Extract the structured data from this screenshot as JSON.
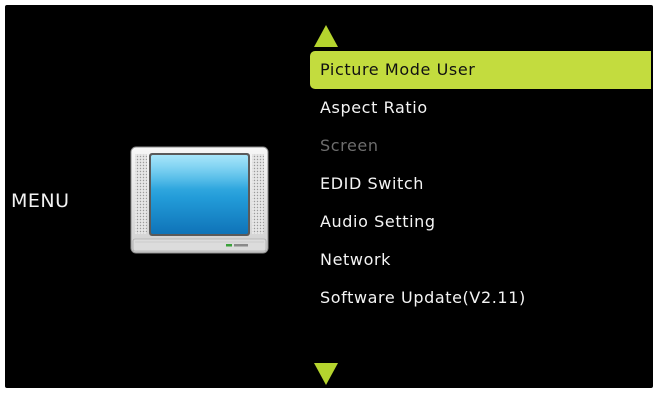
{
  "menu": {
    "title": "MENU",
    "scroll_up_icon": "triangle-up",
    "scroll_down_icon": "triangle-down",
    "accent_color": "#c3dc3e",
    "disabled_color": "#6d6d6d",
    "items": [
      {
        "label": "Picture Mode User",
        "state": "selected"
      },
      {
        "label": "Aspect Ratio",
        "state": "normal"
      },
      {
        "label": "Screen",
        "state": "disabled"
      },
      {
        "label": "EDID Switch",
        "state": "normal"
      },
      {
        "label": "Audio Setting",
        "state": "normal"
      },
      {
        "label": "Network",
        "state": "normal"
      },
      {
        "label": "Software Update(V2.11)",
        "state": "normal"
      }
    ]
  },
  "illustration": {
    "icon": "tv-icon"
  }
}
